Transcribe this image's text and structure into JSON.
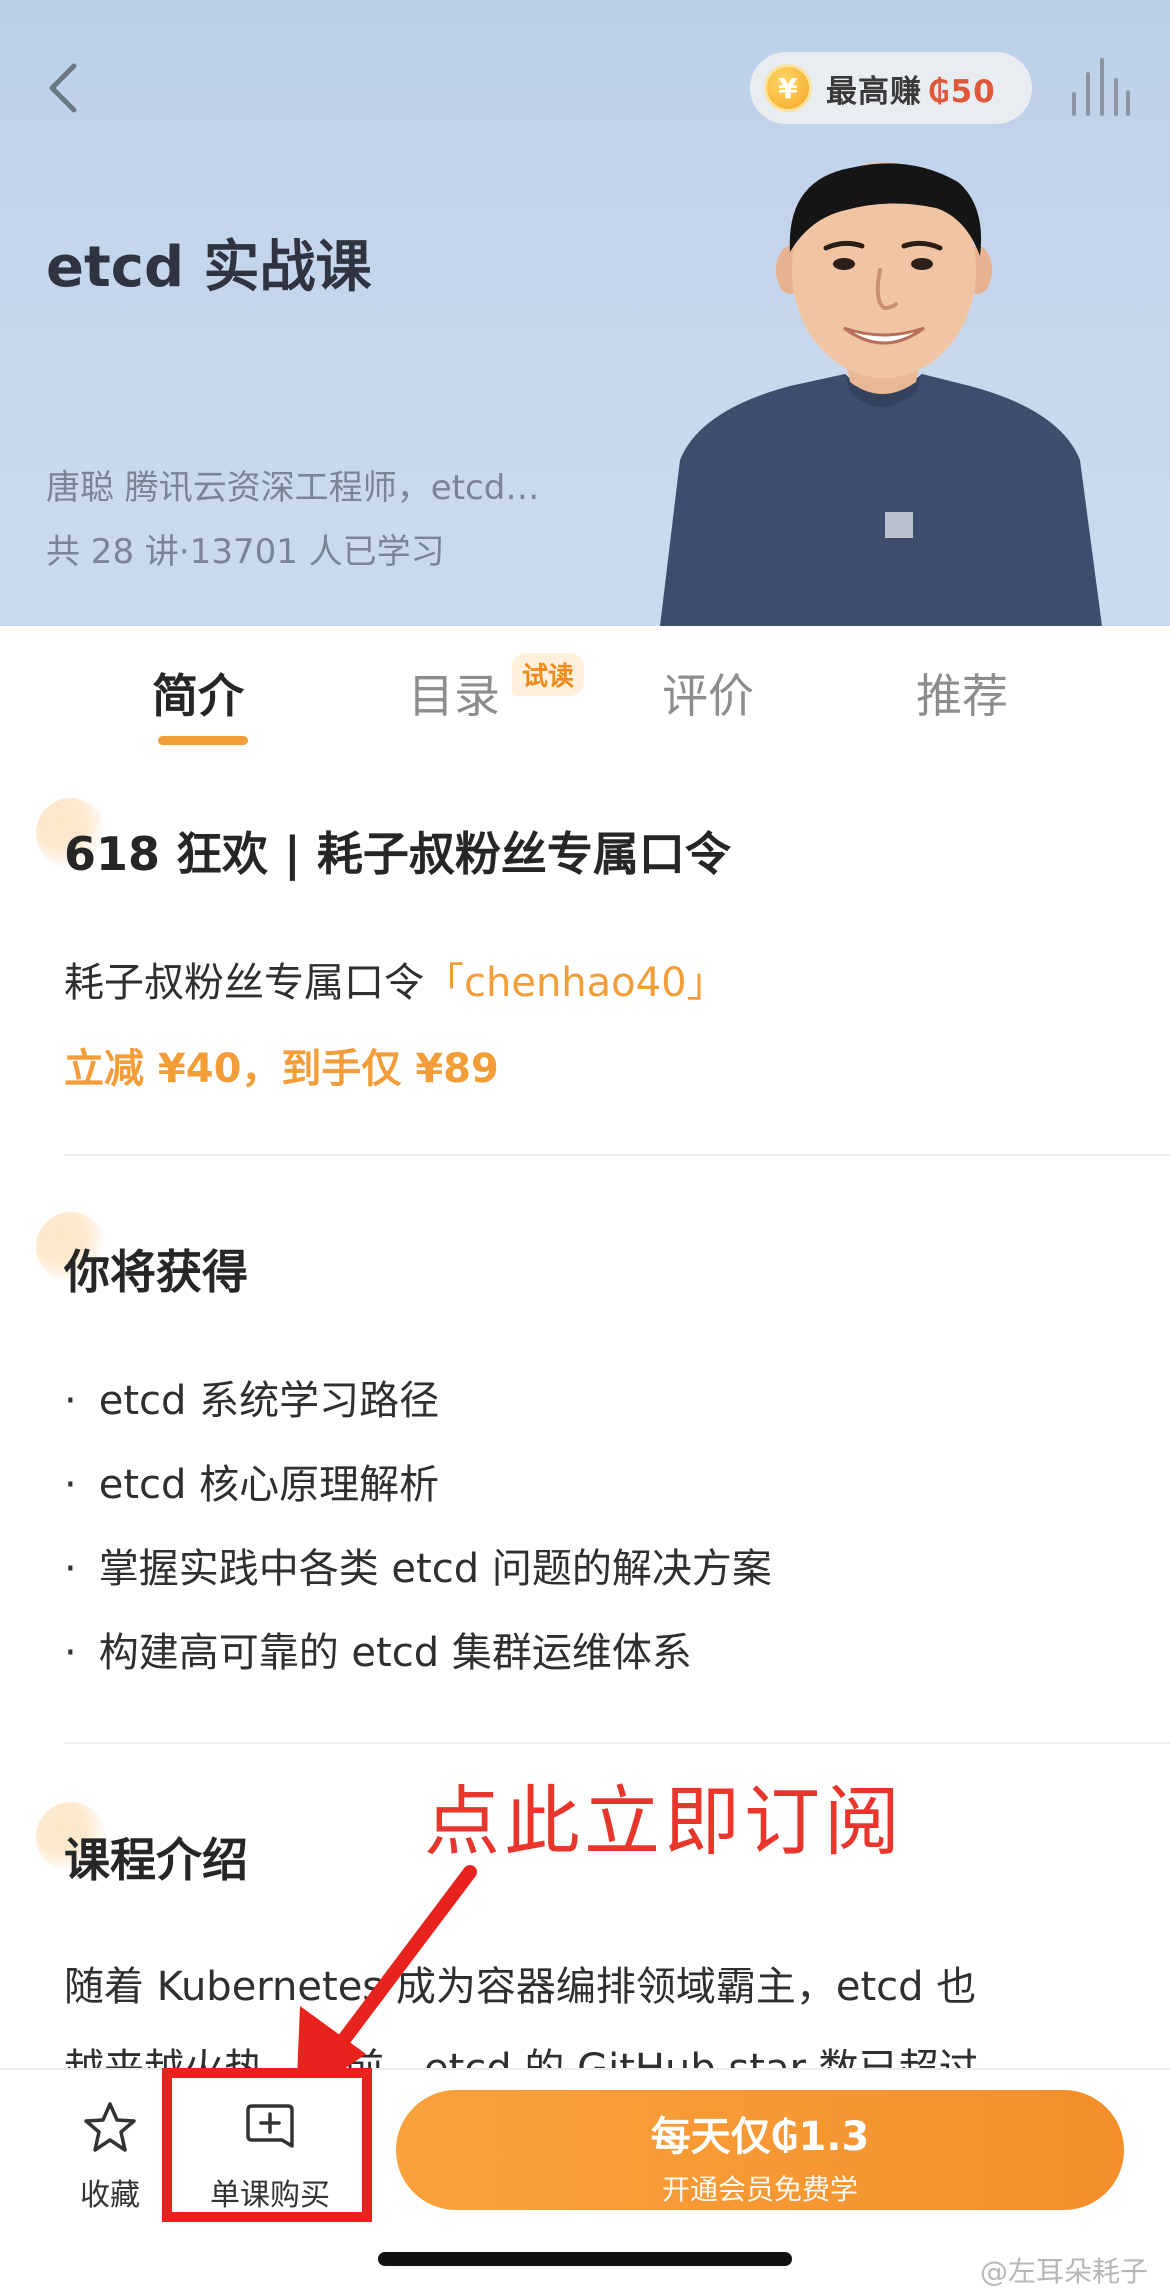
{
  "header": {
    "reward_label": "最高赚",
    "reward_amount": "₲50",
    "coin_symbol": "¥",
    "course_title": "etcd 实战课",
    "teacher": "唐聪 腾讯云资深工程师，etcd…",
    "meta": "共 28 讲·13701 人已学习"
  },
  "tabs": [
    {
      "label": "简介",
      "active": true
    },
    {
      "label": "目录",
      "badge": "试读"
    },
    {
      "label": "评价"
    },
    {
      "label": "推荐"
    }
  ],
  "promo": {
    "title": "618 狂欢 | 耗子叔粉丝专属口令",
    "line1_prefix": "耗子叔粉丝专属口令",
    "line1_code": "「chenhao40」",
    "line2": "立减 ¥40，到手仅 ¥89"
  },
  "gains": {
    "title": "你将获得",
    "items": [
      "etcd 系统学习路径",
      "etcd 核心原理解析",
      "掌握实践中各类 etcd 问题的解决方案",
      "构建高可靠的 etcd 集群运维体系"
    ]
  },
  "intro": {
    "title": "课程介绍",
    "line1": "随着 Kubernetes 成为容器编排领域霸主，etcd 也",
    "line2": "越来越火热。目前，etcd 的 GitHub star 数已超过"
  },
  "annotation": {
    "text": "点此立即订阅",
    "color": "#e8362c"
  },
  "bottom_bar": {
    "collect_label": "收藏",
    "buy_single_label": "单课购买",
    "subscribe_main": "每天仅₲1.3",
    "subscribe_sub": "开通会员免费学"
  },
  "watermark": "@左耳朵耗子",
  "colors": {
    "accent": "#f29d38",
    "annotation_red": "#e8221c"
  }
}
